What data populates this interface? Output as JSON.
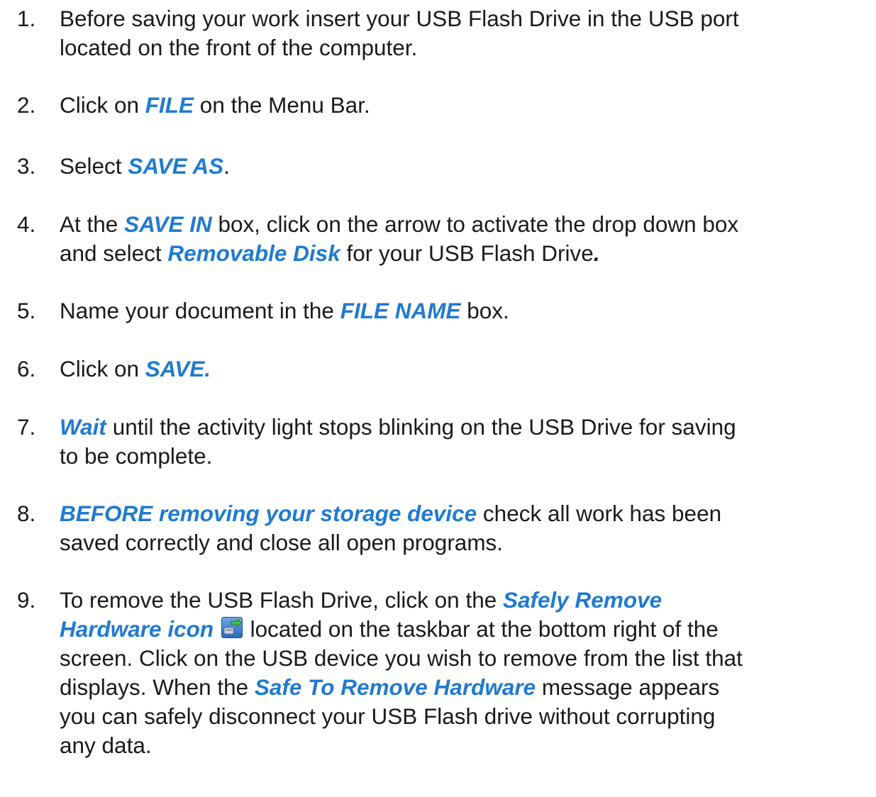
{
  "steps": [
    {
      "number": "1.",
      "lines": [
        [
          {
            "t": "Before saving your work insert your USB Flash Drive in the USB port"
          }
        ],
        [
          {
            "t": "located on the front of the computer."
          }
        ]
      ]
    },
    {
      "number": "2.",
      "lines": [
        [
          {
            "t": "Click on "
          },
          {
            "t": "FILE",
            "em": true
          },
          {
            "t": " on the Menu Bar."
          }
        ]
      ]
    },
    {
      "number": "3.",
      "lines": [
        [
          {
            "t": "Select "
          },
          {
            "t": "SAVE AS",
            "em": true
          },
          {
            "t": "."
          }
        ]
      ]
    },
    {
      "number": "4.",
      "lines": [
        [
          {
            "t": "At the "
          },
          {
            "t": "SAVE IN",
            "em": true
          },
          {
            "t": " box, click on the arrow to activate the drop down box"
          }
        ],
        [
          {
            "t": "and select "
          },
          {
            "t": "Removable Disk",
            "em": true
          },
          {
            "t": " for your USB Flash Drive"
          },
          {
            "t": ".",
            "bolditalic": true
          }
        ]
      ]
    },
    {
      "number": "5.",
      "lines": [
        [
          {
            "t": "Name your document in the "
          },
          {
            "t": "FILE NAME",
            "em": true
          },
          {
            "t": " box."
          }
        ]
      ]
    },
    {
      "number": "6.",
      "lines": [
        [
          {
            "t": "Click on "
          },
          {
            "t": "SAVE.",
            "em": true
          }
        ]
      ]
    },
    {
      "number": "7.",
      "lines": [
        [
          {
            "t": "Wait",
            "em": true
          },
          {
            "t": " until the activity light stops blinking on the USB Drive for saving"
          }
        ],
        [
          {
            "t": "to be complete."
          }
        ]
      ]
    },
    {
      "number": "8.",
      "lines": [
        [
          {
            "t": "BEFORE removing your storage device",
            "em": true
          },
          {
            "t": " check all work has been"
          }
        ],
        [
          {
            "t": "saved correctly and close all open programs."
          }
        ]
      ]
    },
    {
      "number": "9.",
      "lines": [
        [
          {
            "t": "To remove the USB Flash Drive, click on the "
          },
          {
            "t": "Safely Remove",
            "em": true
          }
        ],
        [
          {
            "t": "Hardware icon",
            "em": true
          },
          {
            "t": " "
          },
          {
            "icon": "safely-remove-hardware-icon"
          },
          {
            "t": " located on the taskbar at the bottom right of the"
          }
        ],
        [
          {
            "t": "screen. Click on the USB device you wish to remove from the list that"
          }
        ],
        [
          {
            "t": "displays. When the "
          },
          {
            "t": "Safe To Remove Hardware",
            "em": true
          },
          {
            "t": " message appears"
          }
        ],
        [
          {
            "t": "you can safely disconnect your USB Flash drive without corrupting"
          }
        ],
        [
          {
            "t": "any data."
          }
        ]
      ]
    }
  ],
  "colors": {
    "body_text": "#1a1a1a",
    "emphasis": "#1f7ad1",
    "background": "#ffffff"
  }
}
